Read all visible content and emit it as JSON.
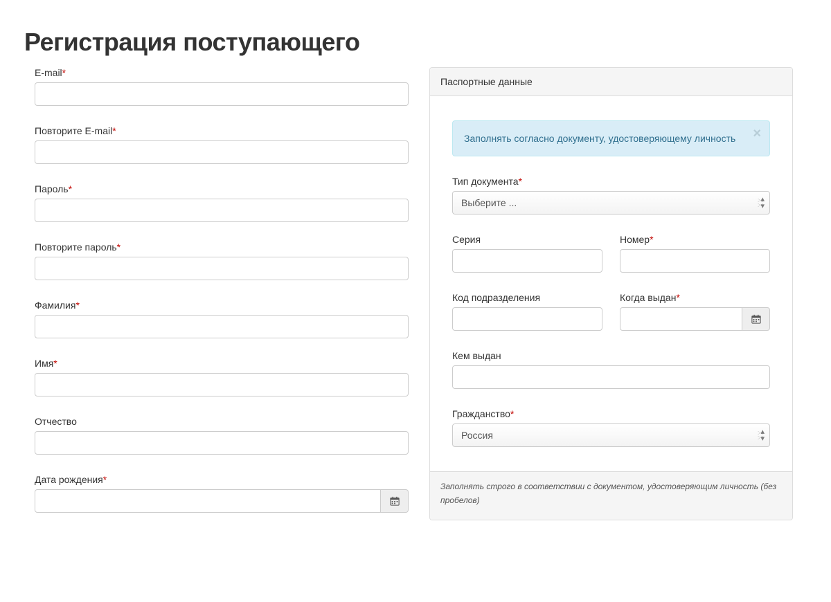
{
  "title": "Регистрация поступающего",
  "left": {
    "email_label": "E-mail",
    "repeat_email_label": "Повторите E-mail",
    "password_label": "Пароль",
    "repeat_password_label": "Повторите пароль",
    "lastname_label": "Фамилия",
    "firstname_label": "Имя",
    "middlename_label": "Отчество",
    "dob_label": "Дата рождения",
    "email_required": true,
    "repeat_email_required": true,
    "password_required": true,
    "repeat_password_required": true,
    "lastname_required": true,
    "firstname_required": true,
    "middlename_required": false,
    "dob_required": true
  },
  "panel": {
    "heading": "Паспортные данные",
    "alert": "Заполнять согласно документу, удостоверяющему личность",
    "doc_type_label": "Тип документа",
    "doc_type_placeholder": "Выберите ...",
    "series_label": "Серия",
    "number_label": "Номер",
    "division_label": "Код подразделения",
    "when_issued_label": "Когда выдан",
    "issued_by_label": "Кем выдан",
    "citizenship_label": "Гражданство",
    "citizenship_value": "Россия",
    "footer": "Заполнять строго в соответствии с документом, удостоверяющим личность (без пробелов)"
  }
}
